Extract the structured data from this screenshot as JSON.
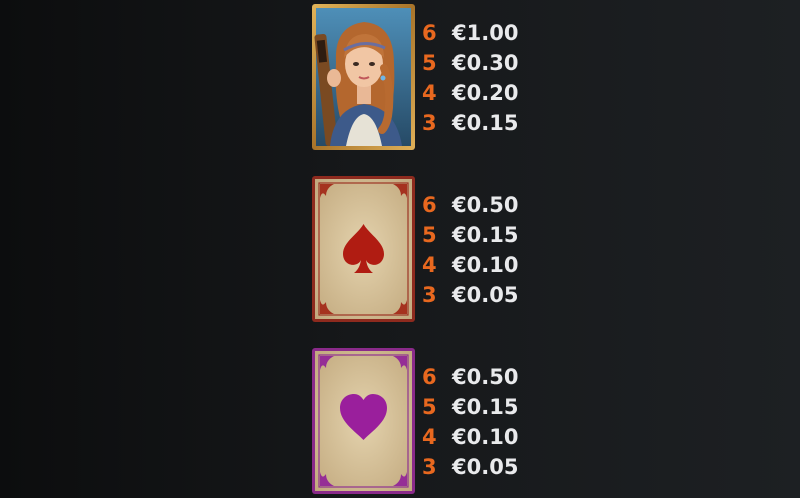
{
  "accent_color": "#e8681f",
  "text_color": "#e9eaec",
  "symbols": [
    {
      "name": "woman-with-lute",
      "icon": "musician-woman-portrait",
      "frame_color": "#c0903a",
      "payouts": [
        {
          "count": "6",
          "amount": "€1.00"
        },
        {
          "count": "5",
          "amount": "€0.30"
        },
        {
          "count": "4",
          "amount": "€0.20"
        },
        {
          "count": "3",
          "amount": "€0.15"
        }
      ]
    },
    {
      "name": "spade-card",
      "icon": "spade-icon",
      "frame_color": "#8e2a1e",
      "payouts": [
        {
          "count": "6",
          "amount": "€0.50"
        },
        {
          "count": "5",
          "amount": "€0.15"
        },
        {
          "count": "4",
          "amount": "€0.10"
        },
        {
          "count": "3",
          "amount": "€0.05"
        }
      ]
    },
    {
      "name": "heart-card",
      "icon": "heart-icon",
      "frame_color": "#8a2a8a",
      "payouts": [
        {
          "count": "6",
          "amount": "€0.50"
        },
        {
          "count": "5",
          "amount": "€0.15"
        },
        {
          "count": "4",
          "amount": "€0.10"
        },
        {
          "count": "3",
          "amount": "€0.05"
        }
      ]
    }
  ]
}
